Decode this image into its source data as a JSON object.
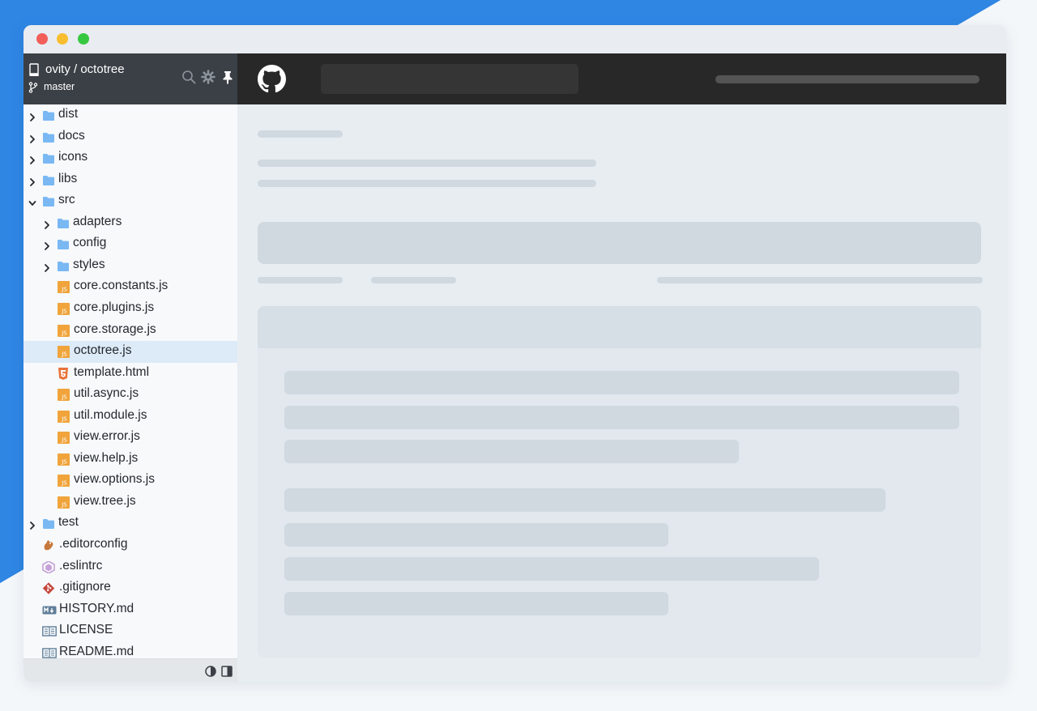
{
  "colors": {
    "brand_blue": "#2f86e3",
    "sidebar_header": "#3b4046",
    "github_header": "#282828",
    "selected_row": "#ddeaf8",
    "js_icon": "#f0a43b",
    "folder_icon": "#79b8f3"
  },
  "window": {
    "controls": [
      "close",
      "minimize",
      "zoom"
    ]
  },
  "sidebar": {
    "repo": "ovity / octotree",
    "branch": "master",
    "header_icons": [
      "search-icon",
      "gear-icon",
      "pin-icon"
    ],
    "footer_icons": [
      "contrast-icon",
      "panel-toggle-icon"
    ],
    "tree": [
      {
        "label": "dist",
        "type": "folder",
        "depth": 0,
        "expanded": false
      },
      {
        "label": "docs",
        "type": "folder",
        "depth": 0,
        "expanded": false
      },
      {
        "label": "icons",
        "type": "folder",
        "depth": 0,
        "expanded": false
      },
      {
        "label": "libs",
        "type": "folder",
        "depth": 0,
        "expanded": false
      },
      {
        "label": "src",
        "type": "folder",
        "depth": 0,
        "expanded": true
      },
      {
        "label": "adapters",
        "type": "folder",
        "depth": 1,
        "expanded": false
      },
      {
        "label": "config",
        "type": "folder",
        "depth": 1,
        "expanded": false
      },
      {
        "label": "styles",
        "type": "folder",
        "depth": 1,
        "expanded": false
      },
      {
        "label": "core.constants.js",
        "type": "js",
        "depth": 1
      },
      {
        "label": "core.plugins.js",
        "type": "js",
        "depth": 1
      },
      {
        "label": "core.storage.js",
        "type": "js",
        "depth": 1
      },
      {
        "label": "octotree.js",
        "type": "js",
        "depth": 1,
        "selected": true
      },
      {
        "label": "template.html",
        "type": "html",
        "depth": 1
      },
      {
        "label": "util.async.js",
        "type": "js",
        "depth": 1
      },
      {
        "label": "util.module.js",
        "type": "js",
        "depth": 1
      },
      {
        "label": "view.error.js",
        "type": "js",
        "depth": 1
      },
      {
        "label": "view.help.js",
        "type": "js",
        "depth": 1
      },
      {
        "label": "view.options.js",
        "type": "js",
        "depth": 1
      },
      {
        "label": "view.tree.js",
        "type": "js",
        "depth": 1
      },
      {
        "label": "test",
        "type": "folder",
        "depth": 0,
        "expanded": false
      },
      {
        "label": ".editorconfig",
        "type": "editorconfig",
        "depth": 0
      },
      {
        "label": ".eslintrc",
        "type": "eslint",
        "depth": 0
      },
      {
        "label": ".gitignore",
        "type": "git",
        "depth": 0
      },
      {
        "label": "HISTORY.md",
        "type": "markdown",
        "depth": 0
      },
      {
        "label": "LICENSE",
        "type": "book",
        "depth": 0
      },
      {
        "label": "README.md",
        "type": "book",
        "depth": 0
      }
    ]
  },
  "main": {
    "header_icons": [
      "github-icon"
    ]
  }
}
